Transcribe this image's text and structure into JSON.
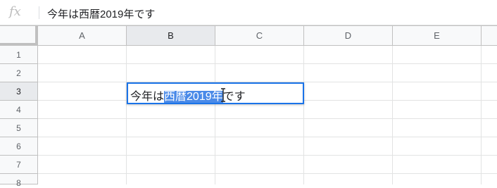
{
  "formula_bar": {
    "fx_label": "fx",
    "value": "今年は西暦2019年です"
  },
  "columns": [
    "A",
    "B",
    "C",
    "D",
    "E"
  ],
  "selected_column": "B",
  "rows": [
    "1",
    "2",
    "3",
    "4",
    "5",
    "6",
    "7",
    "8"
  ],
  "selected_row": "3",
  "active_cell": {
    "address": "B3",
    "text_before": "今年は",
    "text_selected": "西暦2019年",
    "text_after": "です"
  },
  "colors": {
    "selection_border": "#1a73e8",
    "text_highlight": "#4a8ae8",
    "header_bg": "#f8f9fa",
    "selected_header_bg": "#e8eaed"
  }
}
